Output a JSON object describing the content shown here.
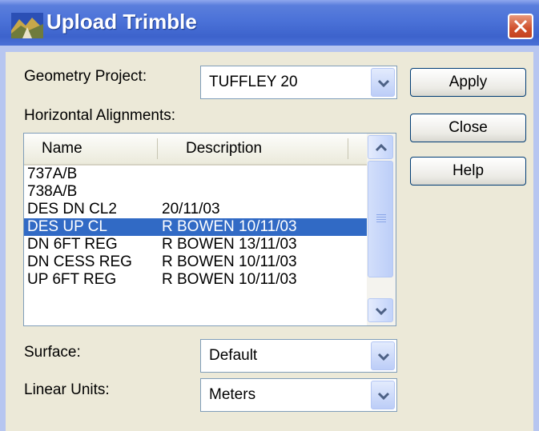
{
  "window": {
    "title": "Upload Trimble",
    "icon": "landscape-app-icon",
    "close_icon": "close-icon"
  },
  "geometry_project": {
    "label": "Geometry Project:",
    "value": "TUFFLEY 20"
  },
  "horizontal_alignments": {
    "label": "Horizontal Alignments:",
    "columns": [
      "Name",
      "Description"
    ],
    "rows": [
      {
        "name": "737A/B",
        "description": ""
      },
      {
        "name": "738A/B",
        "description": ""
      },
      {
        "name": "DES DN CL2",
        "description": "20/11/03"
      },
      {
        "name": "DES UP CL",
        "description": "R BOWEN 10/11/03",
        "selected": true
      },
      {
        "name": "DN 6FT REG",
        "description": "R BOWEN 13/11/03"
      },
      {
        "name": "DN CESS REG",
        "description": "R BOWEN 10/11/03"
      },
      {
        "name": "UP 6FT REG",
        "description": "R BOWEN 10/11/03"
      }
    ]
  },
  "surface": {
    "label": "Surface:",
    "value": "Default"
  },
  "linear_units": {
    "label": "Linear Units:",
    "value": "Meters"
  },
  "buttons": {
    "apply": "Apply",
    "close": "Close",
    "help": "Help"
  },
  "colors": {
    "selection": "#316ac5",
    "titlebar": "#4b72d8",
    "dialog_bg": "#ece9d8"
  }
}
